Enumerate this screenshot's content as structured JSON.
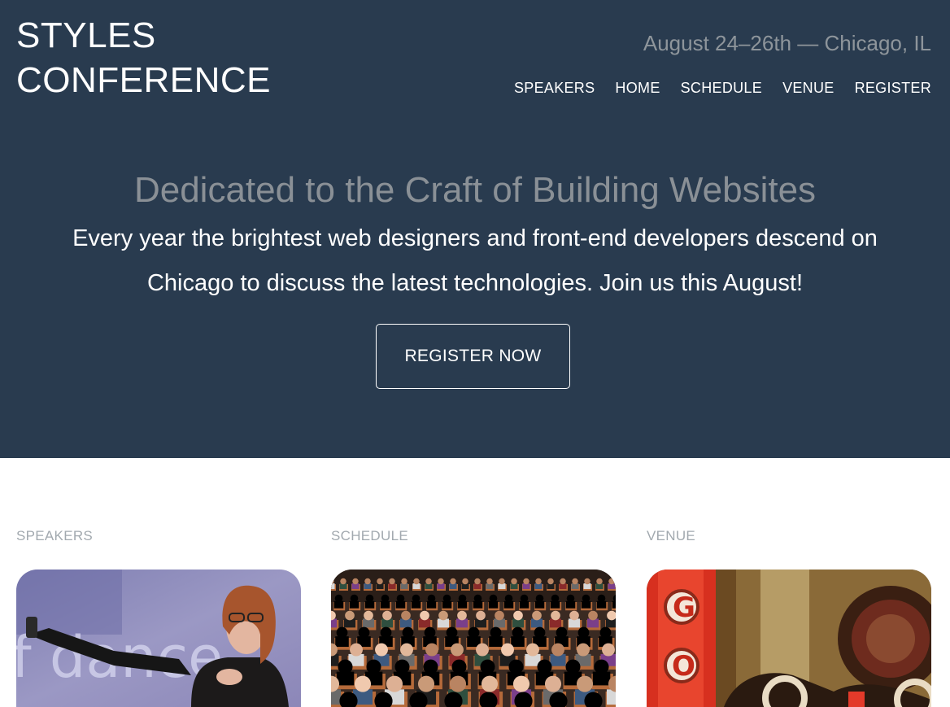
{
  "logo": {
    "line1": "STYLES",
    "line2": "CONFERENCE"
  },
  "tagline": "August 24–26th — Chicago, IL",
  "nav": [
    "SPEAKERS",
    "HOME",
    "SCHEDULE",
    "VENUE",
    "REGISTER"
  ],
  "hero": {
    "title": "Dedicated to the Craft of Building Websites",
    "text": "Every year the brightest web designers and front-end developers descend on Chicago to discuss the latest technologies. Join us this August!",
    "cta": "REGISTER NOW"
  },
  "teasers": [
    {
      "heading": "SPEAKERS"
    },
    {
      "heading": "SCHEDULE"
    },
    {
      "heading": "VENUE"
    }
  ],
  "colors": {
    "header_bg": "#293b4f",
    "muted_text": "#8a9096",
    "teaser_heading": "#a2a9af"
  }
}
